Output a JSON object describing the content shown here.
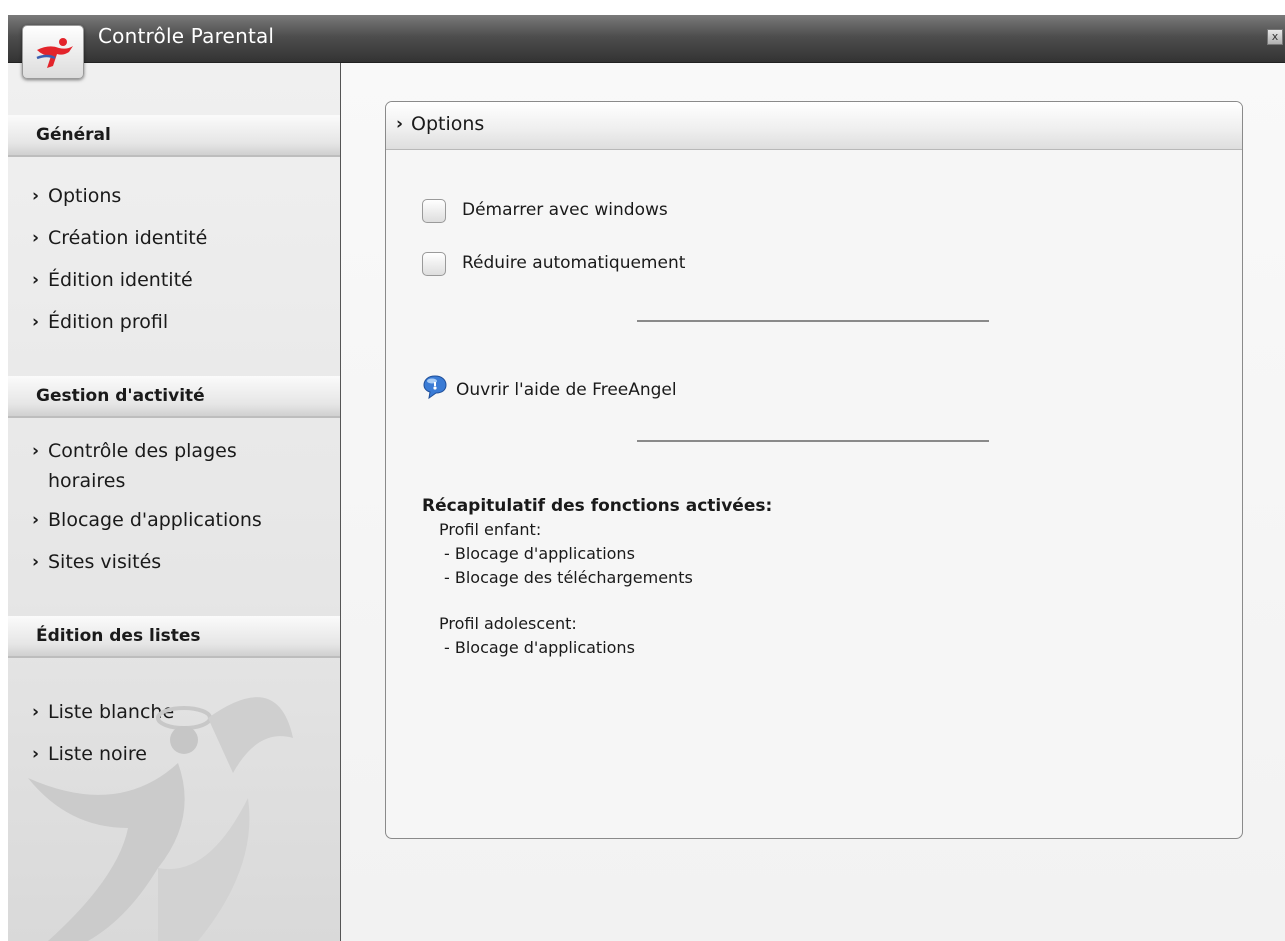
{
  "app": {
    "title": "Contrôle Parental",
    "close_label": "x"
  },
  "sidebar": {
    "sections": [
      {
        "title": "Général",
        "items": [
          "Options",
          "Création identité",
          "Édition identité",
          "Édition profil"
        ]
      },
      {
        "title": "Gestion d'activité",
        "items": [
          "Contrôle des plages horaires",
          "Blocage d'applications",
          "Sites visités"
        ]
      },
      {
        "title": "Édition des listes",
        "items": [
          "Liste blanche",
          "Liste noire"
        ]
      }
    ]
  },
  "panel": {
    "title": "Options",
    "options": [
      {
        "label": "Démarrer avec windows",
        "checked": false
      },
      {
        "label": "Réduire automatiquement",
        "checked": false
      }
    ],
    "help_link": "Ouvrir l'aide de FreeAngel",
    "summary": {
      "heading": "Récapitulatif des fonctions activées:",
      "profiles": [
        {
          "name": "Profil enfant:",
          "items": [
            "- Blocage d'applications",
            "- Blocage des téléchargements"
          ]
        },
        {
          "name": "Profil adolescent:",
          "items": [
            "- Blocage d'applications"
          ]
        }
      ]
    }
  },
  "colors": {
    "titlebar": "#4e4e4e",
    "logo_accent": "#e3242b",
    "help_icon": "#3a7bd5"
  }
}
